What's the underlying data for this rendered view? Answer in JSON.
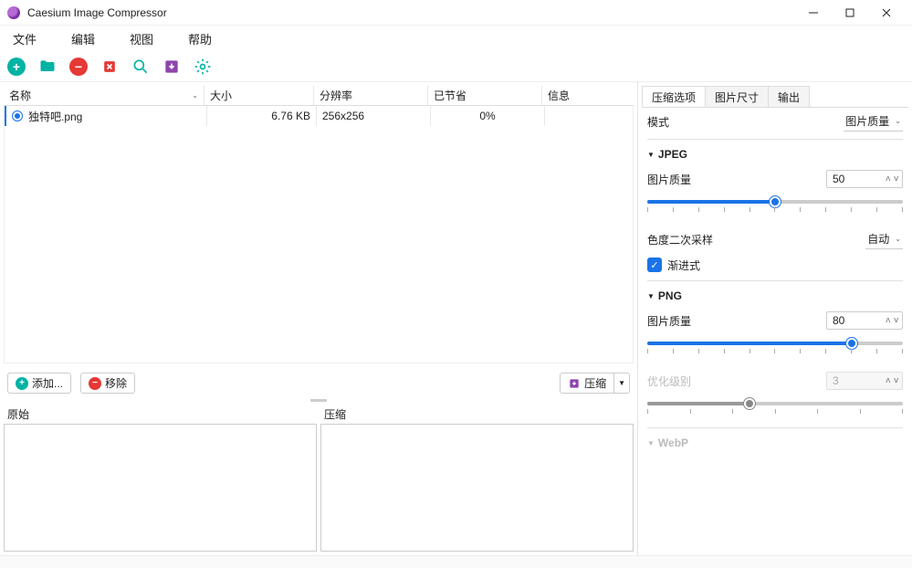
{
  "window": {
    "title": "Caesium Image Compressor"
  },
  "menu": {
    "file": "文件",
    "edit": "编辑",
    "view": "视图",
    "help": "帮助"
  },
  "table": {
    "headers": {
      "name": "名称",
      "size": "大小",
      "resolution": "分辨率",
      "saved": "已节省",
      "info": "信息"
    },
    "rows": [
      {
        "name": "独特吧.png",
        "size": "6.76 KB",
        "resolution": "256x256",
        "saved": "0%",
        "info": ""
      }
    ]
  },
  "buttons": {
    "add": "添加...",
    "remove": "移除",
    "compress": "压缩"
  },
  "preview": {
    "original": "原始",
    "compressed": "压缩"
  },
  "right": {
    "tabs": {
      "options": "压缩选项",
      "size": "图片尺寸",
      "output": "输出"
    },
    "mode_label": "模式",
    "mode_value": "图片质量",
    "jpeg": {
      "title": "JPEG",
      "quality_label": "图片质量",
      "quality_value": "50",
      "chroma_label": "色度二次采样",
      "chroma_value": "自动",
      "progressive_label": "渐进式"
    },
    "png": {
      "title": "PNG",
      "quality_label": "图片质量",
      "quality_value": "80",
      "optlevel_label": "优化级别",
      "optlevel_value": "3"
    },
    "webp": {
      "title": "WebP"
    }
  }
}
